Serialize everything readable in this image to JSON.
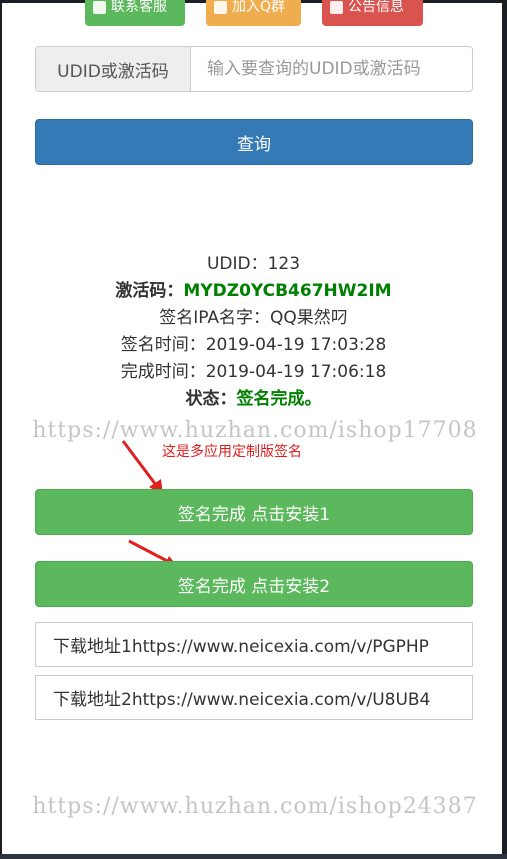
{
  "top_buttons": [
    {
      "label": "联系客服",
      "color": "#5cb85c",
      "icon": "user-icon"
    },
    {
      "label": "加入Q群",
      "color": "#f0ad4e",
      "icon": "heart-icon"
    },
    {
      "label": "公告信息",
      "color": "#d9534f",
      "icon": "edit-icon"
    }
  ],
  "search": {
    "addon_label": "UDID或激活码",
    "placeholder": "输入要查询的UDID或激活码",
    "value": ""
  },
  "query_button": {
    "label": "查询",
    "color": "#337ab7"
  },
  "result": {
    "udid_label": "UDID：",
    "udid_value": "123",
    "code_label": "激活码：",
    "code_value": "MYDZ0YCB467HW2IM",
    "ipa_label": "签名IPA名字：",
    "ipa_value": "QQ果然叼",
    "sign_time_label": "签名时间：",
    "sign_time_value": "2019-04-19 17:03:28",
    "finish_time_label": "完成时间：",
    "finish_time_value": "2019-04-19 17:06:18",
    "status_label": "状态：",
    "status_value": "签名完成。"
  },
  "watermarks": [
    "https://www.huzhan.com/ishop17708",
    "https://www.huzhan.com/ishop24387"
  ],
  "annotation": "这是多应用定制版签名",
  "install_buttons": [
    {
      "label": "签名完成 点击安装1"
    },
    {
      "label": "签名完成 点击安装2"
    }
  ],
  "download_links": [
    {
      "label": "下载地址1https://www.neicexia.com/v/PGPHP"
    },
    {
      "label": "下载地址2https://www.neicexia.com/v/U8UB4"
    }
  ],
  "colors": {
    "success_green": "#5cb85c",
    "status_text_green": "#008000",
    "annotation_red": "#e02020"
  }
}
